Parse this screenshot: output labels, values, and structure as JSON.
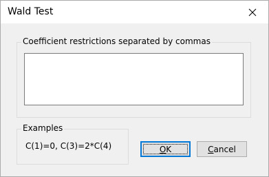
{
  "window": {
    "title": "Wald Test",
    "close_icon": "close-icon"
  },
  "restrictions": {
    "label": "Coefficient restrictions separated by commas",
    "value": ""
  },
  "examples": {
    "label": "Examples",
    "text": "C(1)=0,  C(3)=2*C(4)"
  },
  "buttons": {
    "ok": {
      "mnemonic": "O",
      "rest": "K"
    },
    "cancel": {
      "mnemonic": "C",
      "rest": "ancel"
    }
  },
  "colors": {
    "focus_border": "#0078d7",
    "button_face": "#e1e1e1",
    "dialog_bg": "#f0f0f0"
  }
}
